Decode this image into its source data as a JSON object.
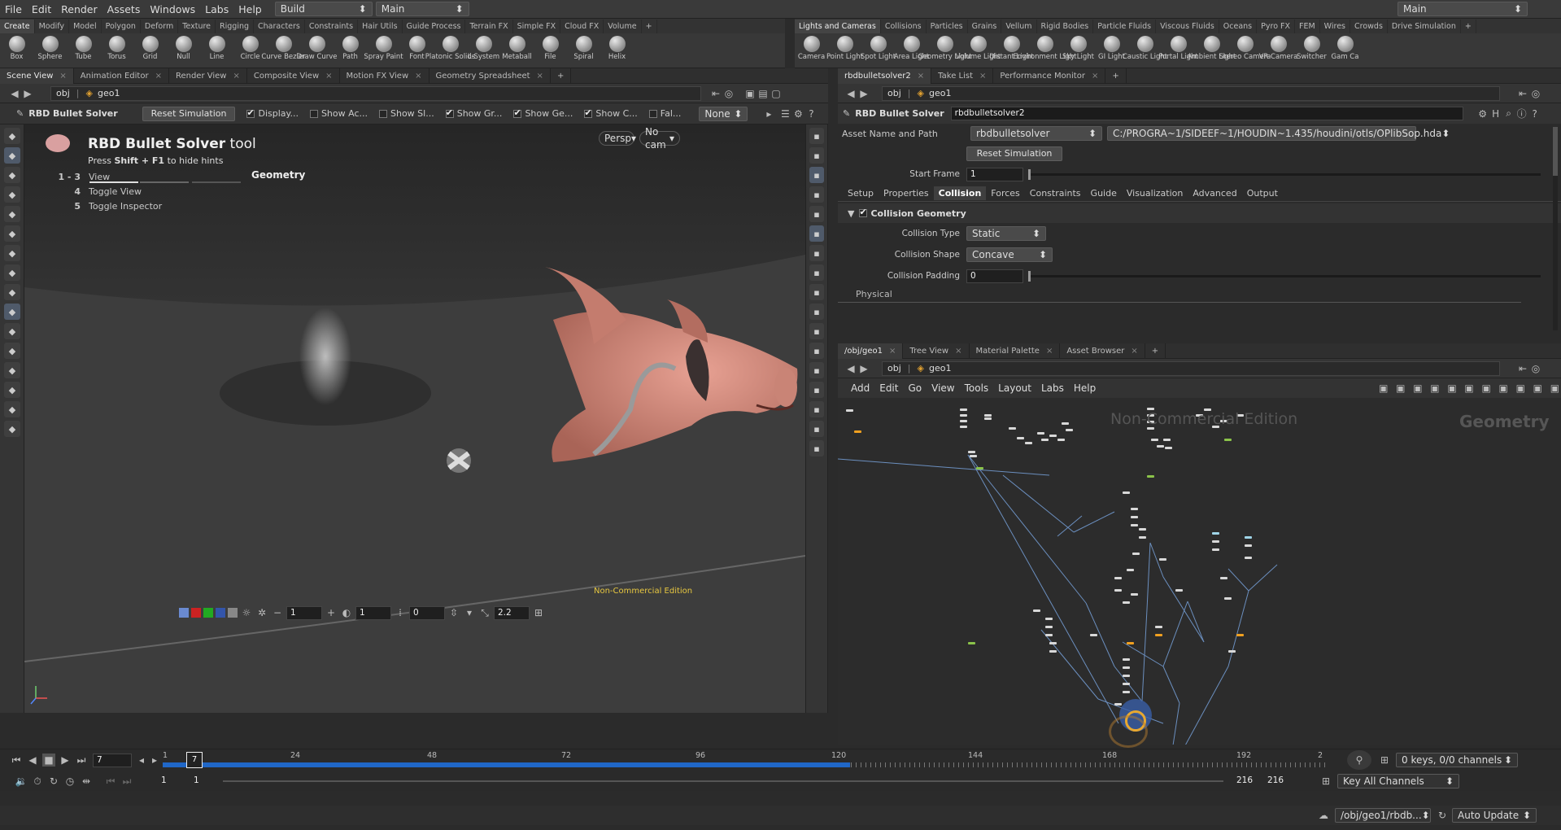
{
  "menubar": {
    "items": [
      "File",
      "Edit",
      "Render",
      "Assets",
      "Windows",
      "Labs",
      "Help"
    ],
    "desktop": "Build",
    "context": "Main",
    "right_context": "Main"
  },
  "left_shelf": {
    "tabs": [
      "Create",
      "Modify",
      "Model",
      "Polygon",
      "Deform",
      "Texture",
      "Rigging",
      "Characters",
      "Constraints",
      "Hair Utils",
      "Guide Process",
      "Terrain FX",
      "Simple FX",
      "Cloud FX",
      "Volume"
    ],
    "tools": [
      "Box",
      "Sphere",
      "Tube",
      "Torus",
      "Grid",
      "Null",
      "Line",
      "Circle",
      "Curve Bezier",
      "Draw Curve",
      "Path",
      "Spray Paint",
      "Font",
      "Platonic Solids",
      "L-System",
      "Metaball",
      "File",
      "Spiral",
      "Helix"
    ]
  },
  "right_shelf": {
    "tabs": [
      "Lights and Cameras",
      "Collisions",
      "Particles",
      "Grains",
      "Vellum",
      "Rigid Bodies",
      "Particle Fluids",
      "Viscous Fluids",
      "Oceans",
      "Pyro FX",
      "FEM",
      "Wires",
      "Crowds",
      "Drive Simulation"
    ],
    "tools": [
      "Camera",
      "Point Light",
      "Spot Light",
      "Area Light",
      "Geometry Light",
      "Volume Light",
      "Distant Light",
      "Environment Light",
      "Sky Light",
      "GI Light",
      "Caustic Light",
      "Portal Light",
      "Ambient Light",
      "Stereo Camera",
      "VR Camera",
      "Switcher",
      "Gam Ca"
    ]
  },
  "viewer": {
    "tabs": [
      "Scene View",
      "Animation Editor",
      "Render View",
      "Composite View",
      "Motion FX View",
      "Geometry Spreadsheet"
    ],
    "path_root": "obj",
    "path_node": "geo1",
    "op_name": "RBD Bullet Solver",
    "reset_label": "Reset Simulation",
    "toggles": [
      "Display...",
      "Show Ac...",
      "Show Sl...",
      "Show Gr...",
      "Show Ge...",
      "Show C...",
      "Fal..."
    ],
    "toggle_states": [
      true,
      false,
      false,
      true,
      true,
      true,
      false
    ],
    "none_label": "None",
    "persp": "Persp",
    "cam": "No cam",
    "tool_title": "RBD Bullet Solver",
    "tool_suffix": "tool",
    "hint_press": "Press",
    "hint_keys": "Shift + F1",
    "hint_rest": "to hide hints",
    "hotkeys": [
      {
        "key": "1 - 3",
        "label": "View"
      },
      {
        "key": "4",
        "label": "Toggle View"
      },
      {
        "key": "5",
        "label": "Toggle Inspector"
      }
    ],
    "context_label": "Geometry",
    "watermark": "Non-Commercial Edition",
    "bottom": {
      "f1": "1",
      "f2": "1",
      "f3": "0",
      "f4": "2.2"
    }
  },
  "params": {
    "tabs": [
      "rbdbulletsolver2",
      "Take List",
      "Performance Monitor"
    ],
    "path_root": "obj",
    "path_node": "geo1",
    "op_type": "RBD Bullet Solver",
    "op_name": "rbdbulletsolver2",
    "asset_label": "Asset Name and Path",
    "asset_name": "rbdbulletsolver",
    "asset_path": "C:/PROGRA~1/SIDEEF~1/HOUDIN~1.435/houdini/otls/OPlibSop.hda",
    "reset_label": "Reset Simulation",
    "start_frame_label": "Start Frame",
    "start_frame": "1",
    "sub_tabs": [
      "Setup",
      "Properties",
      "Collision",
      "Forces",
      "Constraints",
      "Guide",
      "Visualization",
      "Advanced",
      "Output"
    ],
    "active_sub_tab": 2,
    "folder": "Collision Geometry",
    "collision_type_label": "Collision Type",
    "collision_type": "Static",
    "collision_shape_label": "Collision Shape",
    "collision_shape": "Concave",
    "collision_padding_label": "Collision Padding",
    "collision_padding": "0",
    "physical_label": "Physical"
  },
  "network": {
    "tabs": [
      "/obj/geo1",
      "Tree View",
      "Material Palette",
      "Asset Browser"
    ],
    "path_root": "obj",
    "path_node": "geo1",
    "menu": [
      "Add",
      "Edit",
      "Go",
      "View",
      "Tools",
      "Layout",
      "Labs",
      "Help"
    ],
    "watermark": "Non-Commercial Edition",
    "context_label": "Geometry"
  },
  "timeline": {
    "current_frame": "7",
    "ticks": [
      "1",
      "24",
      "48",
      "72",
      "96",
      "120",
      "144",
      "168",
      "192",
      "2"
    ],
    "start": "1",
    "start2": "1",
    "end": "216",
    "end2": "216",
    "keys_label": "0 keys, 0/0 channels",
    "key_all": "Key All Channels"
  },
  "status": {
    "path": "/obj/geo1/rbdb...",
    "update": "Auto Update"
  }
}
